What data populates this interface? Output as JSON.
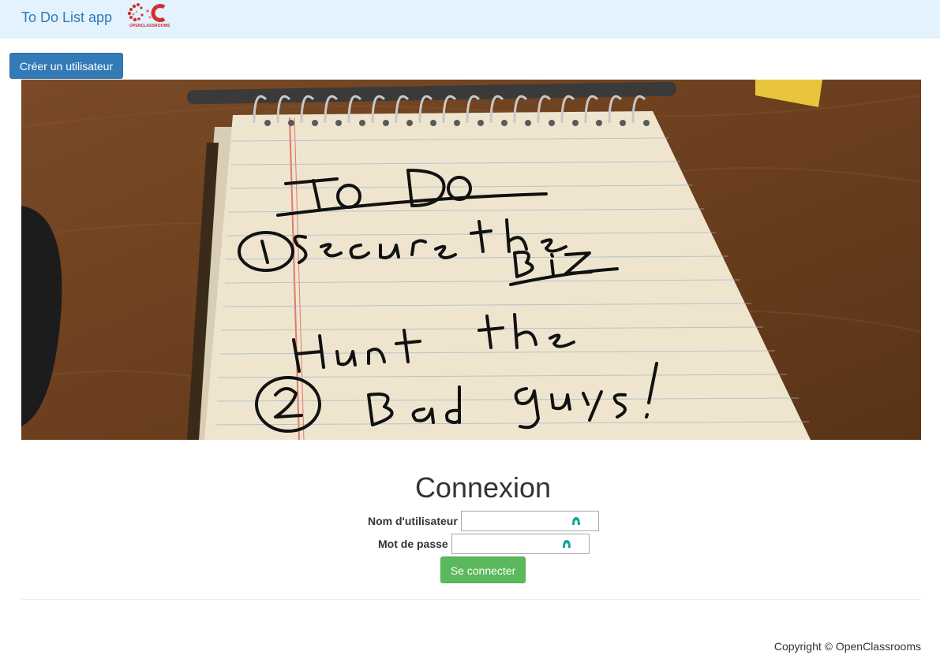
{
  "navbar": {
    "brand": "To Do List app",
    "logo_text": "OPENCLASSROOMS"
  },
  "actions": {
    "create_user_label": "Créer un utilisateur"
  },
  "hero": {
    "icon": "todo-notepad-image"
  },
  "login": {
    "title": "Connexion",
    "username_label": "Nom d'utilisateur",
    "username_value": "",
    "password_label": "Mot de passe",
    "password_value": "",
    "submit_label": "Se connecter"
  },
  "footer": {
    "copyright": "Copyright © OpenClassrooms"
  },
  "colors": {
    "navbar_bg": "#e3f2fd",
    "primary": "#337ab7",
    "success": "#5cb85c",
    "logo_red": "#c62828"
  }
}
